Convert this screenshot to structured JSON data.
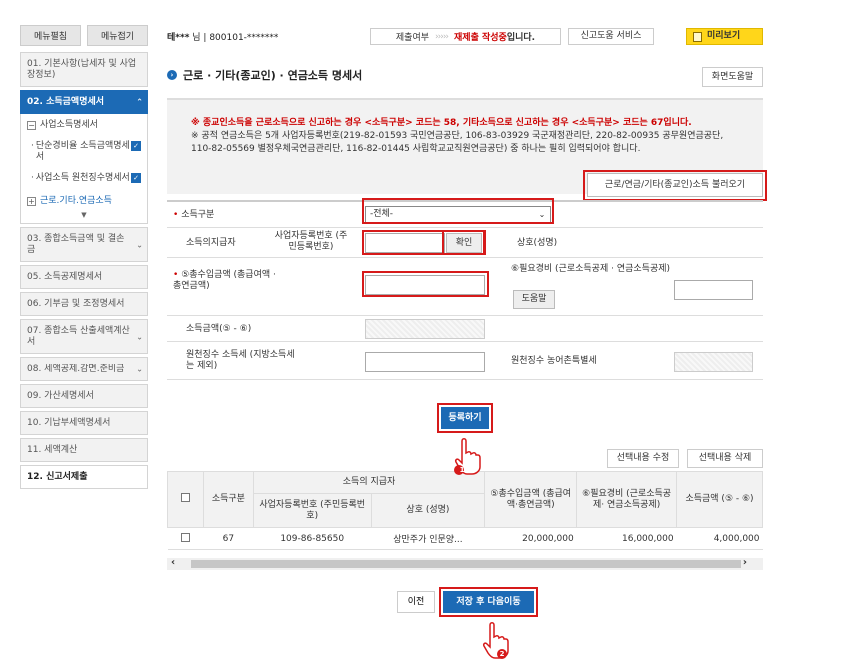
{
  "sidebar": {
    "expand_all": "메뉴펼침",
    "collapse_all": "메뉴접기",
    "items": [
      {
        "label": "01. 기본사항(납세자 및 사업장정보)"
      },
      {
        "label": "02. 소득금액명세서"
      },
      {
        "label": "03. 종합소득금액 및 결손금"
      },
      {
        "label": "05. 소득공제명세서"
      },
      {
        "label": "06. 기부금 및 조정명세서"
      },
      {
        "label": "07. 종합소득 산출세액계산서"
      },
      {
        "label": "08. 세액공제.감면.준비금"
      },
      {
        "label": "09. 가산세명세서"
      },
      {
        "label": "10. 기납부세액명세서"
      },
      {
        "label": "11. 세액계산"
      },
      {
        "label": "12. 신고서제출"
      }
    ],
    "sub": {
      "business": "사업소득명세서",
      "simple_expense": "단순경비율 소득금액명세서",
      "withholding": "사업소득 원천징수명세서",
      "other": "근로.기타.연금소득"
    }
  },
  "header": {
    "user_name": "테***",
    "user_suffix": "님",
    "user_id": "800101-*******",
    "status_label": "제출여부",
    "status_arrows": "›››››",
    "status_red": "재제출 작성중",
    "status_tail": "입니다.",
    "service": "신고도움 서비스",
    "preview": "미리보기"
  },
  "page": {
    "title": "근로 · 기타(종교인) · 연금소득 명세서",
    "help": "화면도움말"
  },
  "notice": {
    "line1": "※ 종교인소득을 근로소득으로 신고하는 경우 <소득구분> 코드는 58, 기타소득으로 신고하는 경우 <소득구분> 코드는 67입니다.",
    "line2": "※ 공적 연금소득은 5개 사업자등록번호(219-82-01593 국민연금공단, 106-83-03929 국군재정관리단, 220-82-00935 공무원연금공단,",
    "line3": "110-82-05569 별정우체국연금관리단, 116-82-01445 사립학교교직원연금공단) 중 하나는 필히 입력되어야 합니다."
  },
  "load_button": "근로/연금/기타(종교인)소득 불러오기",
  "form": {
    "income_type_label": "소득구분",
    "income_type_value": "-전체-",
    "payer_label": "소득의지급자",
    "biz_no_label": "사업자등록번호 (주민등록번호)",
    "confirm": "확인",
    "company_label": "상호(성명)",
    "gross_label": "⑤총수입금액 (총급여액 · 총연금액)",
    "expense_label": "⑥필요경비 (근로소득공제 · 연금소득공제)",
    "help_btn": "도움말",
    "income_label": "소득금액(⑤ - ⑥)",
    "withholding_label": "원천징수 소득세 (지방소득세는 제외)",
    "rural_label": "원천징수 농어촌특별세",
    "register": "등록하기"
  },
  "table": {
    "edit": "선택내용 수정",
    "delete": "선택내용 삭제",
    "headers": {
      "type": "소득구분",
      "payer_group": "소득의 지급자",
      "biz_no": "사업자등록번호 (주민등록번호)",
      "company": "상호 (성명)",
      "gross": "⑤총수입금액 (총급여액·총연금액)",
      "expense": "⑥필요경비 (근로소득공제· 연금소득공제)",
      "income": "소득금액 (⑤ - ⑥)"
    },
    "rows": [
      {
        "type": "67",
        "biz_no": "109-86-85650",
        "company": "상만주가 인문양...",
        "gross": "20,000,000",
        "expense": "16,000,000",
        "income": "4,000,000"
      }
    ]
  },
  "footer": {
    "prev": "이전",
    "next": "저장 후 다음이동"
  },
  "steps": [
    "1",
    "2"
  ],
  "colors": {
    "accent": "#1c6ab5",
    "highlight": "#d61a1a",
    "preview": "#ffd61a"
  }
}
